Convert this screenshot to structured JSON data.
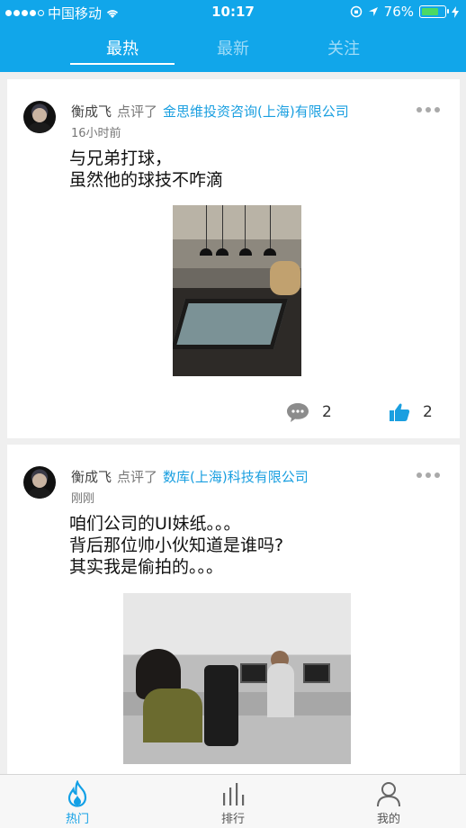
{
  "status_bar": {
    "carrier": "中国移动",
    "time": "10:17",
    "battery_percent": "76%",
    "battery_level": 0.76,
    "signal_bars_filled": 4
  },
  "top_tabs": [
    {
      "label": "最热",
      "active": true
    },
    {
      "label": "最新",
      "active": false
    },
    {
      "label": "关注",
      "active": false
    }
  ],
  "posts": [
    {
      "user": "衡成飞",
      "action": "点评了",
      "company": "金思维投资咨询(上海)有限公司",
      "time_ago": "16小时前",
      "content": "与兄弟打球，\n虽然他的球技不咋滴",
      "comments_count": "2",
      "likes_count": "2"
    },
    {
      "user": "衡成飞",
      "action": "点评了",
      "company": "数库(上海)科技有限公司",
      "time_ago": "刚刚",
      "content": "咱们公司的UI妹纸。。。\n背后那位帅小伙知道是谁吗?\n其实我是偷拍的。。。"
    }
  ],
  "bottom_nav": [
    {
      "label": "热门",
      "icon": "flame-icon",
      "active": true
    },
    {
      "label": "排行",
      "icon": "bar-chart-icon",
      "active": false
    },
    {
      "label": "我的",
      "icon": "person-icon",
      "active": false
    }
  ],
  "colors": {
    "brand_blue": "#11a6ea",
    "company_link": "#1a9fe0",
    "bottom_active": "#12a0e6"
  }
}
